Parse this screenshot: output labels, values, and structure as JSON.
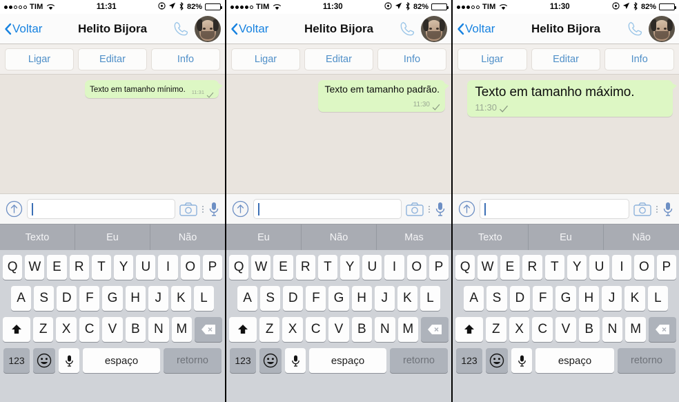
{
  "panels": [
    {
      "id": "minimo",
      "statusbar": {
        "signal_dots": [
          true,
          true,
          false,
          false,
          false
        ],
        "carrier": "TIM",
        "wifi_icon": "wifi-icon",
        "time": "11:31",
        "alarm_icon": "alarm-icon",
        "location_icon": "location-arrow-icon",
        "bluetooth_icon": "bluetooth-icon",
        "battery_percent": "82%",
        "battery_level": 82
      },
      "navbar": {
        "back_label": "Voltar",
        "back_icon": "chevron-left-icon",
        "title": "Helito Bijora",
        "call_icon": "phone-icon",
        "avatar": "contact-avatar"
      },
      "actions": [
        "Ligar",
        "Editar",
        "Info"
      ],
      "message": {
        "text": "Texto em tamanho mínimo.",
        "time": "11:31",
        "status_icon": "single-check-icon",
        "size": "min"
      },
      "inputbar": {
        "attach_icon": "upload-arrow-icon",
        "field_value": "",
        "camera_icon": "camera-icon",
        "more_icon": "more-vertical-icon",
        "mic_icon": "microphone-icon"
      },
      "predictions": [
        "Texto",
        "Eu",
        "Não"
      ]
    },
    {
      "id": "padrao",
      "statusbar": {
        "signal_dots": [
          true,
          true,
          true,
          true,
          false
        ],
        "carrier": "TIM",
        "wifi_icon": "wifi-icon",
        "time": "11:30",
        "alarm_icon": "alarm-icon",
        "location_icon": "location-arrow-icon",
        "bluetooth_icon": "bluetooth-icon",
        "battery_percent": "82%",
        "battery_level": 82
      },
      "navbar": {
        "back_label": "Voltar",
        "back_icon": "chevron-left-icon",
        "title": "Helito Bijora",
        "call_icon": "phone-icon",
        "avatar": "contact-avatar"
      },
      "actions": [
        "Ligar",
        "Editar",
        "Info"
      ],
      "message": {
        "text": "Texto em tamanho padrão.",
        "time": "11:30",
        "status_icon": "single-check-icon",
        "size": "std"
      },
      "inputbar": {
        "attach_icon": "upload-arrow-icon",
        "field_value": "",
        "camera_icon": "camera-icon",
        "more_icon": "more-vertical-icon",
        "mic_icon": "microphone-icon"
      },
      "predictions": [
        "Eu",
        "Não",
        "Mas"
      ]
    },
    {
      "id": "maximo",
      "statusbar": {
        "signal_dots": [
          true,
          true,
          true,
          false,
          false
        ],
        "carrier": "TIM",
        "wifi_icon": "wifi-icon",
        "time": "11:30",
        "alarm_icon": "alarm-icon",
        "location_icon": "location-arrow-icon",
        "bluetooth_icon": "bluetooth-icon",
        "battery_percent": "82%",
        "battery_level": 82
      },
      "navbar": {
        "back_label": "Voltar",
        "back_icon": "chevron-left-icon",
        "title": "Helito Bijora",
        "call_icon": "phone-icon",
        "avatar": "contact-avatar"
      },
      "actions": [
        "Ligar",
        "Editar",
        "Info"
      ],
      "message": {
        "text": "Texto em tamanho máximo.",
        "time": "11:30",
        "status_icon": "single-check-icon",
        "size": "max"
      },
      "inputbar": {
        "attach_icon": "upload-arrow-icon",
        "field_value": "",
        "camera_icon": "camera-icon",
        "more_icon": "more-vertical-icon",
        "mic_icon": "microphone-icon"
      },
      "predictions": [
        "Texto",
        "Eu",
        "Não"
      ]
    }
  ],
  "keyboard": {
    "row1": [
      "Q",
      "W",
      "E",
      "R",
      "T",
      "Y",
      "U",
      "I",
      "O",
      "P"
    ],
    "row2": [
      "A",
      "S",
      "D",
      "F",
      "G",
      "H",
      "J",
      "K",
      "L"
    ],
    "row3": [
      "Z",
      "X",
      "C",
      "V",
      "B",
      "N",
      "M"
    ],
    "shift_icon": "shift-arrow-icon",
    "backspace_icon": "backspace-icon",
    "numeric_label": "123",
    "emoji_icon": "smiley-face-icon",
    "dictation_icon": "microphone-icon",
    "space_label": "espaço",
    "return_label": "retorno"
  },
  "colors": {
    "bubble_green": "#ddf7c4",
    "chat_background": "#e9e4de",
    "accent_blue": "#1782e0",
    "action_blue": "#4f8fc8",
    "keyboard_background": "#d0d3d8",
    "predictive_background": "#a9acb3"
  }
}
